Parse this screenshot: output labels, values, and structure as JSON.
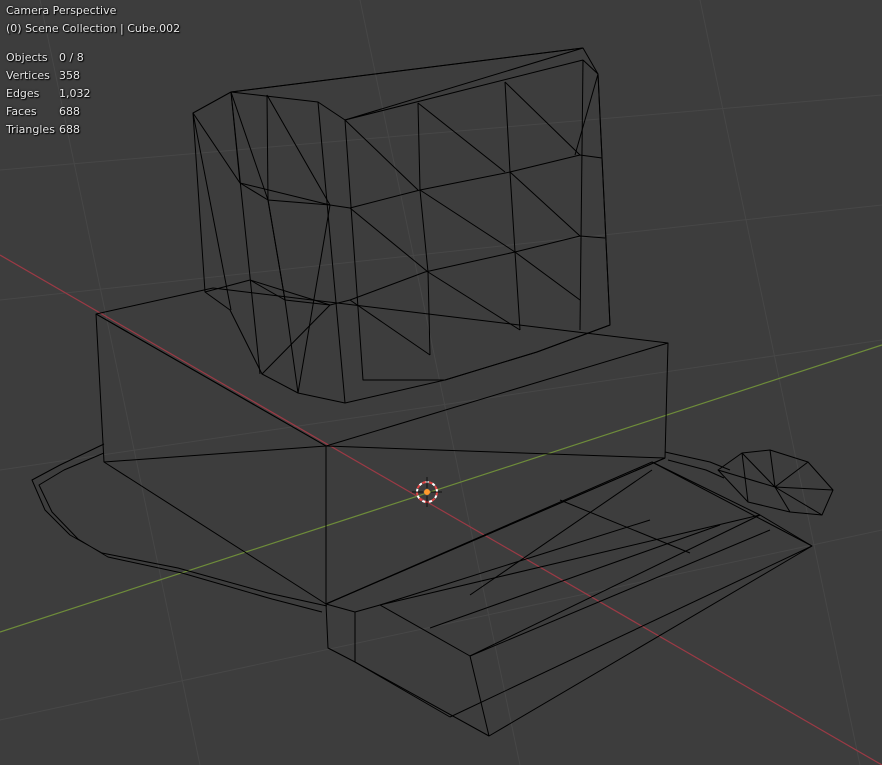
{
  "viewport": {
    "view_name": "Camera Perspective",
    "scene_info": "(0) Scene Collection | Cube.002"
  },
  "stats": [
    {
      "label": "Objects",
      "value": "0 / 8"
    },
    {
      "label": "Vertices",
      "value": "358"
    },
    {
      "label": "Edges",
      "value": "1,032"
    },
    {
      "label": "Faces",
      "value": "688"
    },
    {
      "label": "Triangles",
      "value": "688"
    }
  ],
  "colors": {
    "background": "#3d3d3d",
    "wire": "#000000",
    "grid_line": "#474747",
    "axis_x": "#9b3a45",
    "axis_y": "#6e8c3a",
    "cursor_red": "#e04545",
    "cursor_center": "#ff9a2e"
  },
  "icons": {
    "cursor": "3d-cursor-icon"
  }
}
